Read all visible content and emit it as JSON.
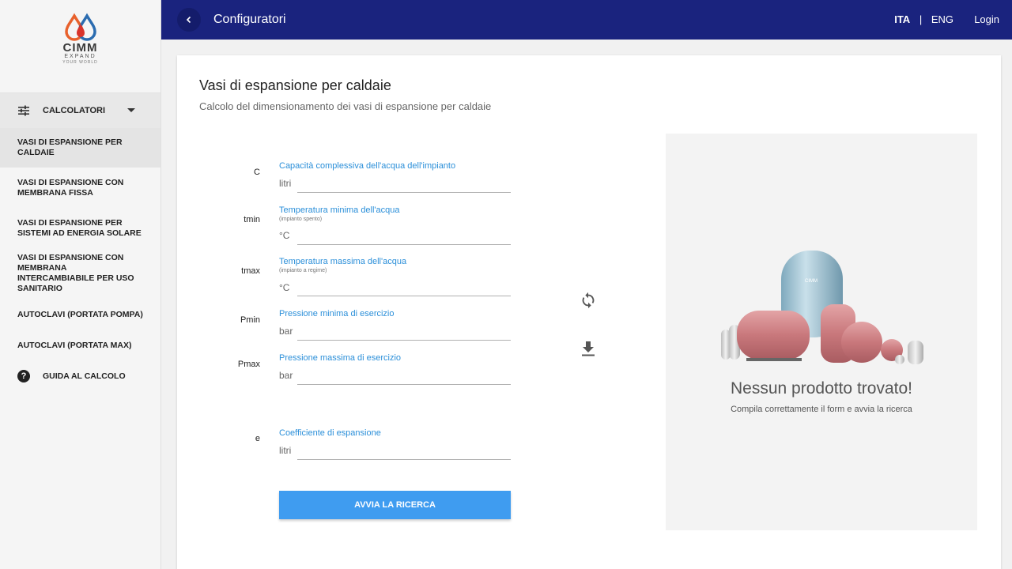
{
  "brand": {
    "name": "CIMM",
    "tagline1": "EXPAND",
    "tagline2": "YOUR WORLD",
    "colors": {
      "orange": "#e8612c",
      "blue": "#2b6cb0",
      "red": "#d9342b"
    }
  },
  "topbar": {
    "title": "Configuratori",
    "lang_ita": "ITA",
    "lang_sep": "|",
    "lang_eng": "ENG",
    "login": "Login",
    "color": "#1a237e"
  },
  "sidebar": {
    "group_label": "CALCOLATORI",
    "items": [
      {
        "label": "VASI DI ESPANSIONE PER CALDAIE",
        "active": true
      },
      {
        "label": "VASI DI ESPANSIONE CON MEMBRANA FISSA",
        "active": false
      },
      {
        "label": "VASI DI ESPANSIONE PER SISTEMI AD ENERGIA SOLARE",
        "active": false
      },
      {
        "label": "VASI DI ESPANSIONE CON MEMBRANA INTERCAMBIABILE PER USO SANITARIO",
        "active": false
      },
      {
        "label": "AUTOCLAVI (PORTATA POMPA)",
        "active": false
      },
      {
        "label": "AUTOCLAVI (PORTATA MAX)",
        "active": false
      }
    ],
    "guide_label": "GUIDA AL CALCOLO"
  },
  "main": {
    "title": "Vasi di espansione per caldaie",
    "subtitle": "Calcolo del dimensionamento dei vasi di espansione per caldaie",
    "fields": [
      {
        "symbol": "C",
        "label": "Capacità complessiva dell'acqua dell'impianto",
        "hint": "",
        "unit": "litri",
        "value": ""
      },
      {
        "symbol": "tmin",
        "label": "Temperatura minima dell'acqua",
        "hint": "(impianto spento)",
        "unit": "°C",
        "value": ""
      },
      {
        "symbol": "tmax",
        "label": "Temperatura massima dell'acqua",
        "hint": "(impianto a regime)",
        "unit": "°C",
        "value": ""
      },
      {
        "symbol": "Pmin",
        "label": "Pressione minima di esercizio",
        "hint": "",
        "unit": "bar",
        "value": ""
      },
      {
        "symbol": "Pmax",
        "label": "Pressione massima di esercizio",
        "hint": "",
        "unit": "bar",
        "value": ""
      },
      {
        "symbol": "e",
        "label": "Coefficiente di espansione",
        "hint": "",
        "unit": "litri",
        "value": ""
      }
    ],
    "search_button": "AVVIA LA RICERCA",
    "accent_color": "#3f9cf0"
  },
  "result": {
    "title": "Nessun prodotto trovato!",
    "subtitle": "Compila correttamente il form e avvia la ricerca"
  }
}
